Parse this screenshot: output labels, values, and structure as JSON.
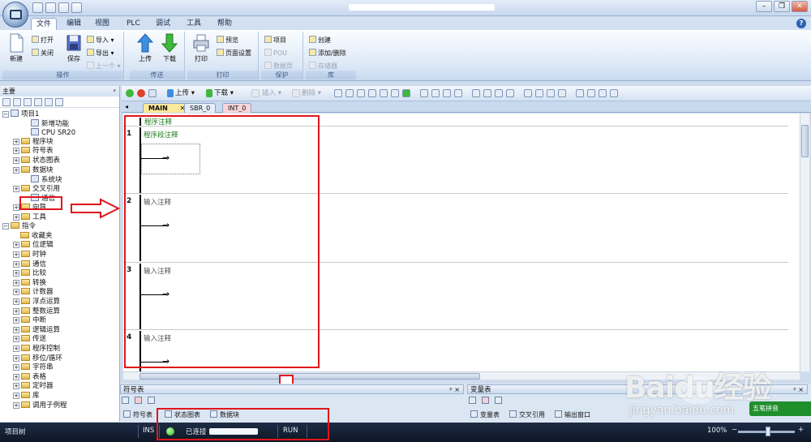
{
  "window": {
    "close_symbol": "✕",
    "minimize_symbol": "–",
    "maximize_symbol": "❐"
  },
  "ribbon_tabs": [
    "文件",
    "编辑",
    "视图",
    "PLC",
    "调试",
    "工具",
    "帮助"
  ],
  "help_label": "?",
  "ribbon": {
    "operation": {
      "label": "操作",
      "new": "新建",
      "open": "打开",
      "close": "关闭",
      "save": "保存",
      "import": "导入 ▾",
      "export": "导出 ▾",
      "previous": "上一个 ▾"
    },
    "transfer": {
      "label": "传送",
      "upload": "上传",
      "download": "下载"
    },
    "print": {
      "label": "打印",
      "print": "打印",
      "preview": "预览",
      "page_setup": "页面设置"
    },
    "protect": {
      "label": "保护",
      "project": "项目",
      "pou": "POU",
      "data_page": "数据页"
    },
    "library": {
      "label": "库",
      "create": "创建",
      "add_remove": "添加/删除",
      "memory": "存储器"
    }
  },
  "left_panel": {
    "title": "主要",
    "pin": "ᵖ",
    "tree": [
      {
        "label": "项目1",
        "level": 0,
        "expander": "−",
        "icon": "project"
      },
      {
        "label": "新增功能",
        "level": 2,
        "expander": "",
        "icon": "item"
      },
      {
        "label": "CPU SR20",
        "level": 2,
        "expander": "",
        "icon": "item"
      },
      {
        "label": "程序块",
        "level": 1,
        "expander": "+",
        "icon": "folder"
      },
      {
        "label": "符号表",
        "level": 1,
        "expander": "+",
        "icon": "folder"
      },
      {
        "label": "状态图表",
        "level": 1,
        "expander": "+",
        "icon": "folder"
      },
      {
        "label": "数据块",
        "level": 1,
        "expander": "+",
        "icon": "folder"
      },
      {
        "label": "系统块",
        "level": 2,
        "expander": "",
        "icon": "item"
      },
      {
        "label": "交叉引用",
        "level": 1,
        "expander": "+",
        "icon": "folder"
      },
      {
        "label": "通信",
        "level": 2,
        "expander": "",
        "icon": "item"
      },
      {
        "label": "向导",
        "level": 1,
        "expander": "+",
        "icon": "folder"
      },
      {
        "label": "工具",
        "level": 1,
        "expander": "+",
        "icon": "folder"
      },
      {
        "label": "指令",
        "level": 0,
        "expander": "−",
        "icon": "folder"
      },
      {
        "label": "收藏夹",
        "level": 1,
        "expander": "",
        "icon": "folder"
      },
      {
        "label": "位逻辑",
        "level": 1,
        "expander": "+",
        "icon": "folder"
      },
      {
        "label": "时钟",
        "level": 1,
        "expander": "+",
        "icon": "folder"
      },
      {
        "label": "通信",
        "level": 1,
        "expander": "+",
        "icon": "folder"
      },
      {
        "label": "比较",
        "level": 1,
        "expander": "+",
        "icon": "folder"
      },
      {
        "label": "转换",
        "level": 1,
        "expander": "+",
        "icon": "folder"
      },
      {
        "label": "计数器",
        "level": 1,
        "expander": "+",
        "icon": "folder"
      },
      {
        "label": "浮点运算",
        "level": 1,
        "expander": "+",
        "icon": "folder"
      },
      {
        "label": "整数运算",
        "level": 1,
        "expander": "+",
        "icon": "folder"
      },
      {
        "label": "中断",
        "level": 1,
        "expander": "+",
        "icon": "folder"
      },
      {
        "label": "逻辑运算",
        "level": 1,
        "expander": "+",
        "icon": "folder"
      },
      {
        "label": "传送",
        "level": 1,
        "expander": "+",
        "icon": "folder"
      },
      {
        "label": "程序控制",
        "level": 1,
        "expander": "+",
        "icon": "folder"
      },
      {
        "label": "移位/循环",
        "level": 1,
        "expander": "+",
        "icon": "folder"
      },
      {
        "label": "字符串",
        "level": 1,
        "expander": "+",
        "icon": "folder"
      },
      {
        "label": "表格",
        "level": 1,
        "expander": "+",
        "icon": "folder"
      },
      {
        "label": "定时器",
        "level": 1,
        "expander": "+",
        "icon": "folder"
      },
      {
        "label": "库",
        "level": 1,
        "expander": "+",
        "icon": "folder"
      },
      {
        "label": "调用子例程",
        "level": 1,
        "expander": "+",
        "icon": "folder"
      }
    ]
  },
  "toolbar": {
    "upload": "上传 ▾",
    "download": "下载 ▾",
    "insert": "插入 ▾",
    "delete": "删除 ▾"
  },
  "program_tabs": {
    "main": "MAIN",
    "main_close": "✕",
    "sbr": "SBR_0",
    "int": "INT_0"
  },
  "editor": {
    "program_comment": "程序注释",
    "networks": [
      {
        "number": "1",
        "comment": "程序段注释"
      },
      {
        "number": "2",
        "comment": "输入注释"
      },
      {
        "number": "3",
        "comment": "输入注释"
      },
      {
        "number": "4",
        "comment": "输入注释"
      }
    ],
    "coil_symbol": "→"
  },
  "bottom": {
    "symbol_table": "符号表",
    "variable_table": "变量表",
    "pane_pin": "ᵖ ×",
    "tabs_left": [
      "符号表",
      "状态图表",
      "数据块"
    ],
    "tabs_right": [
      "变量表",
      "交叉引用",
      "输出窗口"
    ]
  },
  "status": {
    "project_tree": "项目树",
    "ins": "INS",
    "connected": "已连接",
    "run": "RUN",
    "zoom": "100%",
    "zoom_minus": "−",
    "zoom_plus": "+"
  },
  "ime_label": "五笔拼音",
  "watermark": {
    "brand": "Baidu经验",
    "url": "jingyan.baidu.com"
  },
  "colors": {
    "annotation_red": "#e0161b",
    "main_tab": "#fbe89a",
    "connected_green": "#2fb11b"
  }
}
